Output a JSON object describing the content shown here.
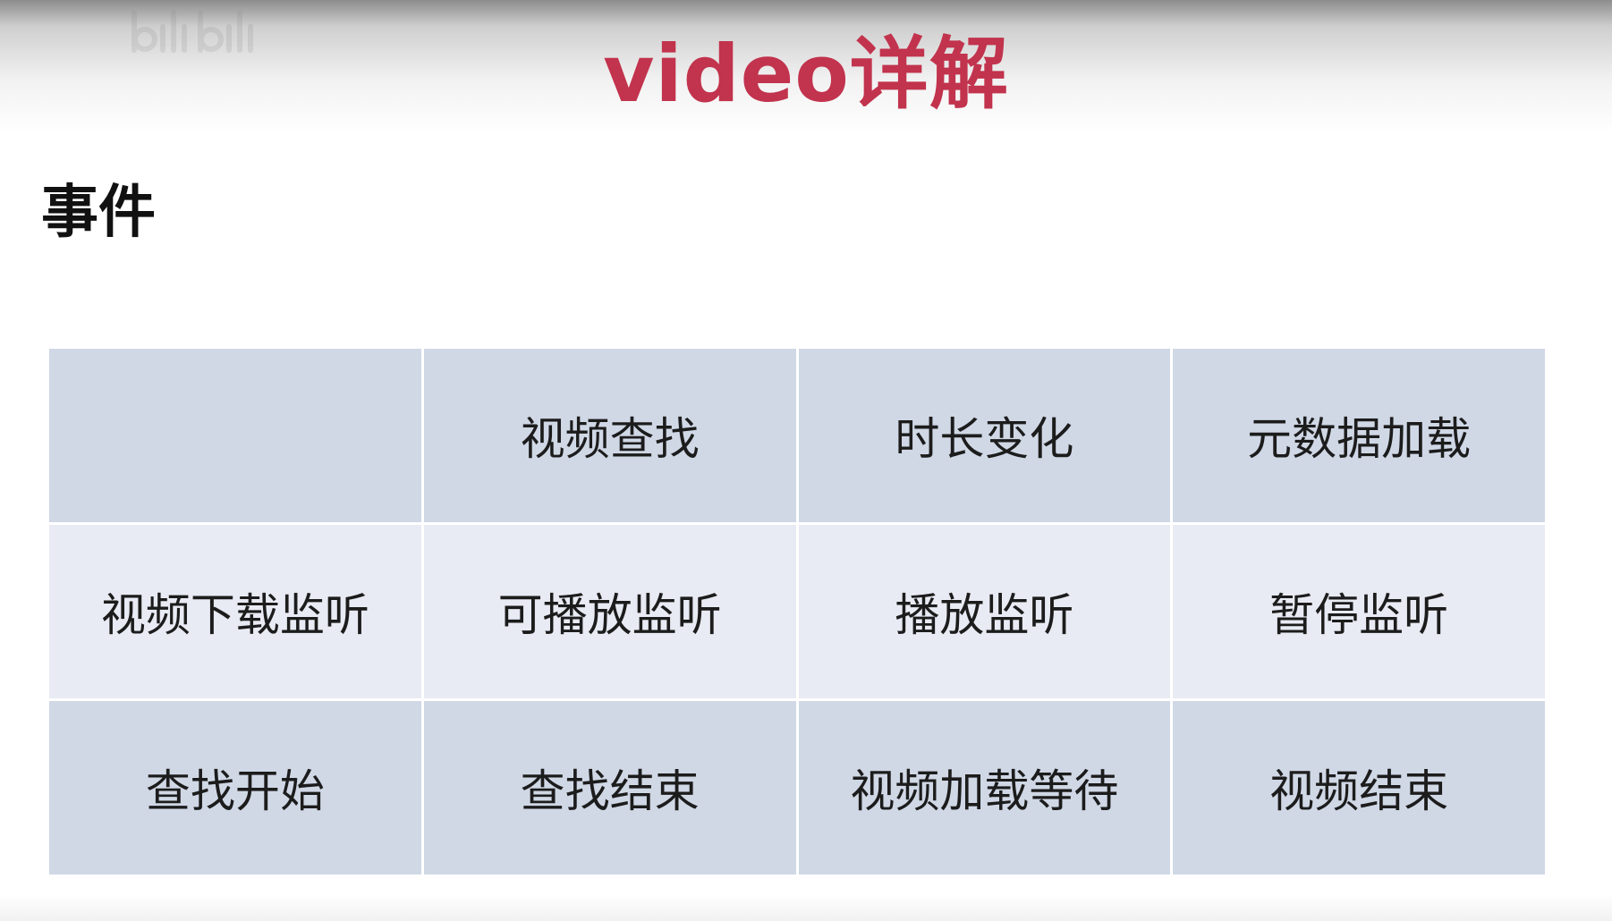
{
  "header": {
    "title": "video详解",
    "watermark_text": "bilibili"
  },
  "section": {
    "title": "事件"
  },
  "table": {
    "rows": [
      [
        "",
        "视频查找",
        "时长变化",
        "元数据加载"
      ],
      [
        "视频下载监听",
        "可播放监听",
        "播放监听",
        "暂停监听"
      ],
      [
        "查找开始",
        "查找结束",
        "视频加载等待",
        "视频结束"
      ]
    ]
  },
  "colors": {
    "title": "#c2334d",
    "cell_dark": "#d0d8e6",
    "cell_light": "#e8ebf3"
  }
}
